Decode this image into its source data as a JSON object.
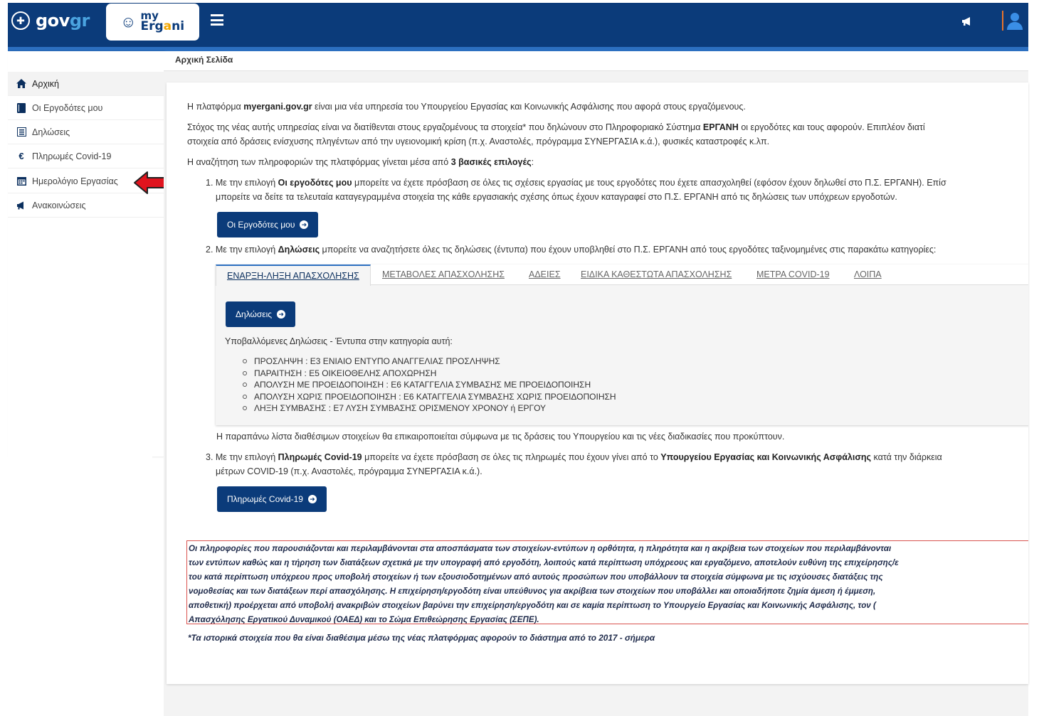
{
  "header": {
    "gov_text_a": "gov",
    "gov_text_b": "gr",
    "app_my": "my",
    "app_name_a": "Erg",
    "app_name_b": "a",
    "app_name_c": "ni"
  },
  "breadcrumb": "Αρχική Σελίδα",
  "sidebar": {
    "items": [
      {
        "label": "Αρχική",
        "icon": "home-icon"
      },
      {
        "label": "Οι Εργοδότες μου",
        "icon": "book-icon"
      },
      {
        "label": "Δηλώσεις",
        "icon": "list-icon"
      },
      {
        "label": "Πληρωμές Covid-19",
        "icon": "euro-icon"
      },
      {
        "label": "Ημερολόγιο Εργασίας",
        "icon": "calendar-icon"
      },
      {
        "label": "Ανακοινώσεις",
        "icon": "megaphone-icon"
      }
    ]
  },
  "content": {
    "intro_a": "Η πλατφόρμα ",
    "intro_b": "myergani.gov.gr",
    "intro_c": " είναι μια νέα υπηρεσία του Υπουργείου Εργασίας και Κοινωνικής Ασφάλισης που αφορά στους εργαζόμενους.",
    "goal_a": "Στόχος της νέας αυτής υπηρεσίας είναι να διατίθενται στους εργαζομένους τα στοιχεία* που δηλώνουν στο Πληροφοριακό Σύστημα ",
    "goal_b": "ΕΡΓΑΝΗ",
    "goal_c": " οι εργοδότες και τους αφορούν. Επιπλέον διατί",
    "goal_line2": "στοιχεία από δράσεις ενίσχυσης πληγέντων από την υγειονομική κρίση (π.χ. Αναστολές, πρόγραμμα ΣΥΝΕΡΓΑΣΙΑ κ.ά.), φυσικές καταστροφές κ.λπ.",
    "search_a": "Η αναζήτηση των πληροφοριών της πλατφόρμας γίνεται μέσα από ",
    "search_b": "3 βασικές επιλογές",
    "search_c": ":",
    "opt1_a": "1. Με την επιλογή ",
    "opt1_b": "Οι εργοδότες μου",
    "opt1_c": " μπορείτε να έχετε πρόσβαση σε όλες τις σχέσεις εργασίας με τους εργοδότες που έχετε απασχοληθεί (εφόσον έχουν δηλωθεί στο Π.Σ. ΕΡΓΑΝΗ). Επίσ",
    "opt1_line2": "μπορείτε να δείτε τα τελευταία καταγεγραμμένα στοιχεία της κάθε εργασιακής σχέσης όπως έχουν καταγραφεί στο Π.Σ. ΕΡΓΑΝΗ από τις δηλώσεις των υπόχρεων εργοδοτών.",
    "btn_employers": "Οι Εργοδότες μου",
    "opt2_a": "2. Με την επιλογή ",
    "opt2_b": "Δηλώσεις",
    "opt2_c": " μπορείτε να αναζητήσετε όλες τις δηλώσεις (έντυπα) που έχουν υποβληθεί στο Π.Σ. ΕΡΓΑΝΗ από τους εργοδότες ταξινομημένες στις παρακάτω κατηγορίες:",
    "tabs": [
      "ΕΝΑΡΞΗ-ΛΗΞΗ ΑΠΑΣΧΟΛΗΣΗΣ",
      "ΜΕΤΑΒΟΛΕΣ ΑΠΑΣΧΟΛΗΣΗΣ",
      "ΑΔΕΙΕΣ",
      "ΕΙΔΙΚΑ ΚΑΘΕΣΤΩΤΑ ΑΠΑΣΧΟΛΗΣΗΣ",
      "ΜΕΤΡΑ COVID-19",
      "ΛΟΙΠΑ"
    ],
    "btn_declarations": "Δηλώσεις",
    "submitted_label": "Υποβαλλόμενες Δηλώσεις - Έντυπα στην κατηγορία αυτή:",
    "forms": [
      "ΠΡΟΣΛΗΨΗ : Ε3 ΕΝΙΑΙΟ ΕΝΤΥΠΟ ΑΝΑΓΓΕΛΙΑΣ ΠΡΟΣΛΗΨΗΣ",
      "ΠΑΡΑΙΤΗΣΗ : Ε5 ΟΙΚΕΙΟΘΕΛΗΣ ΑΠΟΧΩΡΗΣΗ",
      "ΑΠΟΛΥΣΗ ΜΕ ΠΡΟΕΙΔΟΠΟΙΗΣΗ : Ε6 ΚΑΤΑΓΓΕΛΙΑ ΣΥΜΒΑΣΗΣ ΜΕ ΠΡΟΕΙΔΟΠΟΙΗΣΗ",
      "ΑΠΟΛΥΣΗ ΧΩΡΙΣ ΠΡΟΕΙΔΟΠΟΙΗΣΗ : Ε6 ΚΑΤΑΓΓΕΛΙΑ ΣΥΜΒΑΣΗΣ ΧΩΡΙΣ ΠΡΟΕΙΔΟΠΟΙΗΣΗ",
      "ΛΗΞΗ ΣΥΜΒΑΣΗΣ : Ε7 ΛΥΣΗ ΣΥΜΒΑΣΗΣ ΟΡΙΣΜΕΝΟΥ ΧΡΟΝΟΥ ή ΕΡΓΟΥ"
    ],
    "list_update": "Η παραπάνω λίστα διαθέσιμων στοιχείων θα επικαιροποιείται σύμφωνα με τις δράσεις του Υπουργείου και τις νέες διαδικασίες που προκύπτουν.",
    "opt3_a": "3. Με την επιλογή ",
    "opt3_b": "Πληρωμές Covid-19",
    "opt3_c": " μπορείτε να έχετε πρόσβαση σε όλες τις πληρωμές που έχουν γίνει από το ",
    "opt3_d": "Υπουργείου Εργασίας και Κοινωνικής Ασφάλισης",
    "opt3_e": " κατά την διάρκεια",
    "opt3_line2": "μέτρων COVID-19 (π.χ. Αναστολές, πρόγραμμα ΣΥΝΕΡΓΑΣΙΑ κ.ά.).",
    "btn_payments": "Πληρωμές Covid-19",
    "disclaimer_lines": [
      "Οι πληροφορίες που παρουσιάζονται και περιλαμβάνονται στα αποσπάσματα των στοιχείων-εντύπων η ορθότητα, η πληρότητα και η ακρίβεια των στοιχείων που περιλαμβάνονται",
      "των εντύπων καθώς και η τήρηση των διατάξεων σχετικά με την υπογραφή από εργοδότη, λοιπούς κατά περίπτωση υπόχρεους και εργαζόμενο, αποτελούν ευθύνη της επιχείρησης/ε",
      "του κατά περίπτωση υπόχρεου προς υποβολή στοιχείων ή των εξουσιοδοτημένων από αυτούς προσώπων που υποβάλλουν τα στοιχεία σύμφωνα με τις ισχύουσες διατάξεις της",
      "νομοθεσίας και των διατάξεων περί απασχόλησης. Η επιχείρηση/εργοδότη είναι υπεύθυνος για ακρίβεια των στοιχείων που υποβάλλει και οποιαδήποτε ζημία άμεση ή έμμεση,",
      "αποθετική) προέρχεται από υποβολή ανακριβών στοιχείων βαρύνει την επιχείρηση/εργοδότη και σε καμία περίπτωση το Υπουργείο Εργασίας και Κοινωνικής Ασφάλισης, τον (",
      "Απασχόλησης Εργατικού Δυναμικού (ΟΑΕΔ) και το Σώμα Επιθεώρησης Εργασίας (ΣΕΠΕ)."
    ],
    "footnote": "*Τα ιστορικά στοιχεία που θα είναι διαθέσιμα μέσω της νέας πλατφόρμας αφορούν το διάστημα από το 2017 - σήμερα"
  },
  "colors": {
    "header": "#0b3b7a",
    "header_stripe": "#2c6fc0",
    "button": "#0b3b7a",
    "annotation_arrow": "#e0141e",
    "disclaimer_border": "#d9534f"
  }
}
